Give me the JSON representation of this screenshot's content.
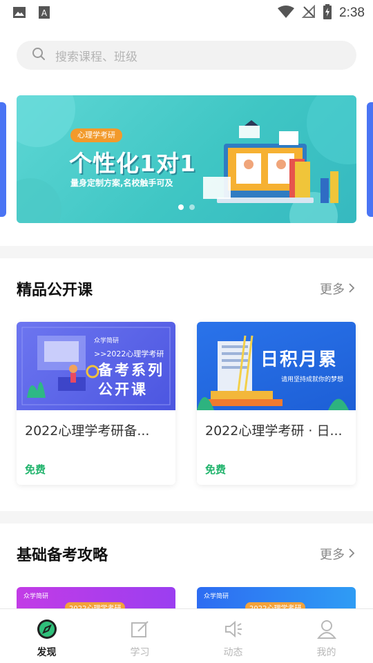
{
  "status_bar": {
    "time": "2:38",
    "icons": [
      "image-icon",
      "font-icon",
      "wifi-icon",
      "no-signal-icon",
      "battery-charging-icon"
    ]
  },
  "search": {
    "placeholder": "搜索课程、班级"
  },
  "banner": {
    "tag": "心理学考研",
    "title": "个性化1对1",
    "subtitle": "量身定制方案,名校触手可及",
    "pages": 2,
    "active_page": 1
  },
  "section_featured": {
    "title": "精品公开课",
    "more": "更多",
    "cards": [
      {
        "title": "2022心理学考研备...",
        "price": "免费",
        "thumb_logo": "众学简研",
        "thumb_line": ">>2022心理学考研",
        "thumb_big1": "备考系列",
        "thumb_big2": "公开课"
      },
      {
        "title": "2022心理学考研 · 日...",
        "price": "免费",
        "thumb_big1": "日积月累",
        "thumb_sub": "请用坚持成就你的梦想"
      }
    ]
  },
  "section_basic": {
    "title": "基础备考攻略",
    "more": "更多",
    "thumb_logo_1": "众学简研",
    "thumb_tag_1": "2022心理学考研",
    "thumb_logo_2": "众学简研",
    "thumb_tag_2": "2022心理学考研"
  },
  "bottom_nav": [
    {
      "label": "发现",
      "icon": "compass-icon",
      "active": true
    },
    {
      "label": "学习",
      "icon": "edit-icon",
      "active": false
    },
    {
      "label": "动态",
      "icon": "speaker-icon",
      "active": false
    },
    {
      "label": "我的",
      "icon": "user-icon",
      "active": false
    }
  ],
  "colors": {
    "accent_blue": "#4a74f4",
    "free_green": "#1fb36b",
    "banner_teal": "#3fc6c4"
  }
}
